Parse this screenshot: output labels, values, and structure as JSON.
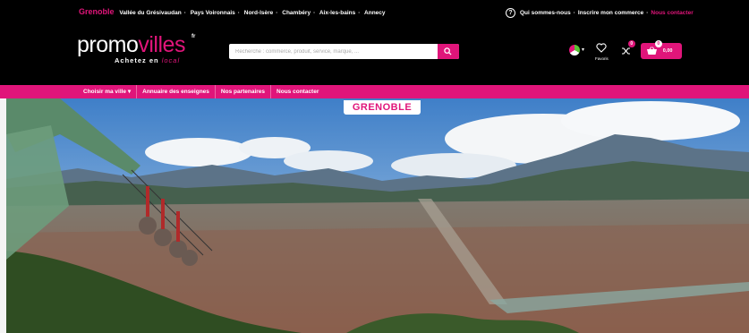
{
  "topbar": {
    "current_city": "Grenoble",
    "cities": [
      "Vallée du Grésivaudan",
      "Pays Voironnais",
      "Nord-Isère",
      "Chambéry",
      "Aix-les-bains",
      "Annecy"
    ],
    "links": [
      "Qui sommes-nous",
      "Inscrire mon commerce",
      "Nous contacter"
    ]
  },
  "logo": {
    "word_part1": "promo",
    "word_part2": "villes",
    "suffix": "fr",
    "tagline_part1": "Achetez en",
    "tagline_part2": "local"
  },
  "search": {
    "placeholder": "Recherche : commerce, produit, service, marque, ...",
    "button_icon": "search-icon"
  },
  "user": {
    "favorites_label": "Favoris",
    "compare_count": "0",
    "cart_count": "0",
    "cart_amount": "0,00"
  },
  "nav": {
    "items": [
      "Choisir ma ville",
      "Annuaire des enseignes",
      "Nos partenaires",
      "Nous contacter"
    ]
  },
  "hero": {
    "city_label": "GRENOBLE"
  },
  "colors": {
    "accent": "#e0157a",
    "background": "#000000"
  }
}
